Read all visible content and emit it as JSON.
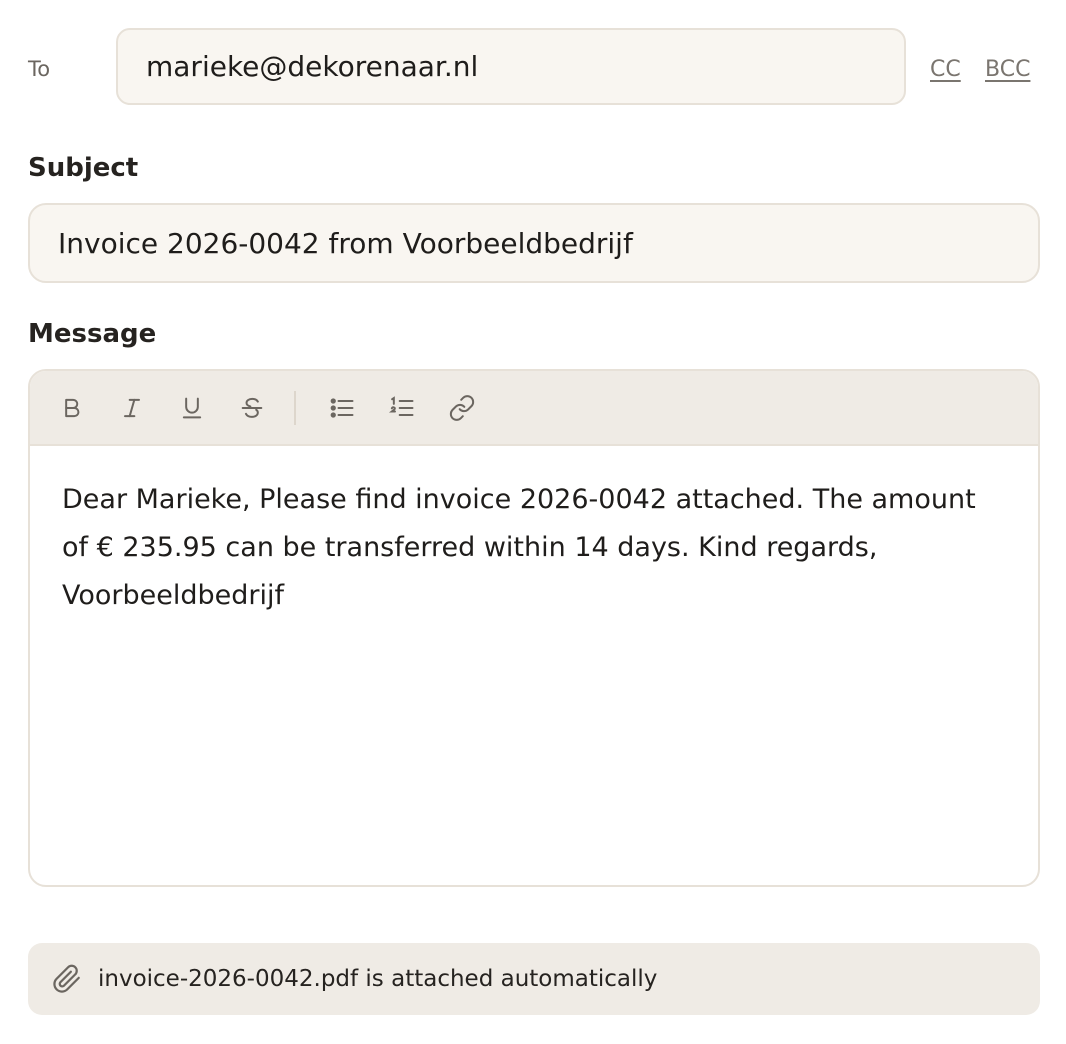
{
  "to": {
    "label": "To",
    "value": "marieke@dekorenaar.nl",
    "cc_label": "CC",
    "bcc_label": "BCC"
  },
  "subject": {
    "label": "Subject",
    "value": "Invoice 2026-0042 from Voorbeeldbedrijf"
  },
  "message": {
    "label": "Message",
    "toolbar": [
      "bold-icon",
      "italic-icon",
      "underline-icon",
      "strikethrough-icon",
      "bullet-list-icon",
      "numbered-list-icon",
      "link-icon"
    ],
    "body": "Dear Marieke, Please find invoice 2026-0042 attached. The amount of € 235.95 can be transferred within 14 days. Kind regards, Voorbeeldbedrijf"
  },
  "attachment": {
    "icon": "paperclip-icon",
    "text": "invoice-2026-0042.pdf is attached automatically"
  }
}
